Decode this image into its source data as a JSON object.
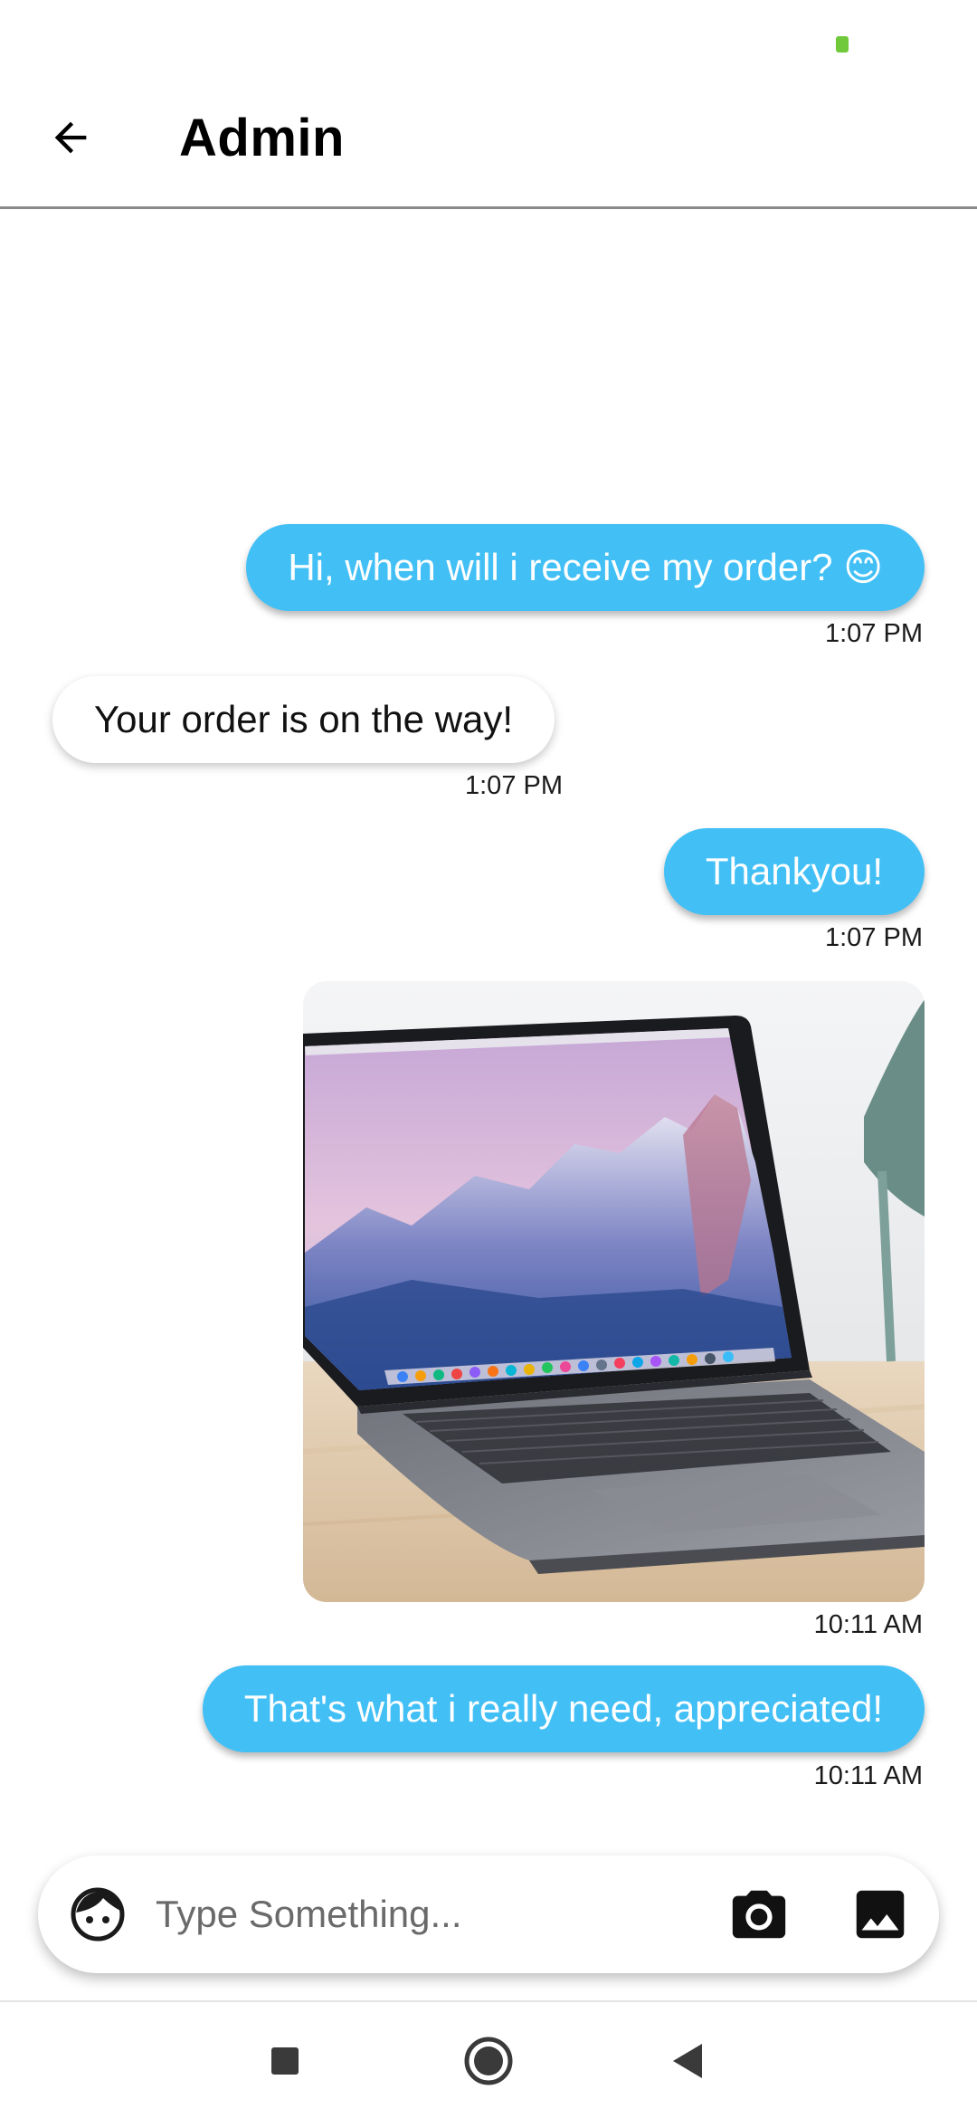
{
  "header": {
    "title": "Admin"
  },
  "messages": [
    {
      "direction": "outgoing",
      "type": "text",
      "text": "Hi, when will i receive my order? 😊",
      "time": "1:07 PM"
    },
    {
      "direction": "incoming",
      "type": "text",
      "text": "Your order is on the way!",
      "time": "1:07 PM"
    },
    {
      "direction": "outgoing",
      "type": "text",
      "text": "Thankyou!",
      "time": "1:07 PM"
    },
    {
      "direction": "outgoing",
      "type": "image",
      "image": "laptop-photo",
      "time": "10:11 AM"
    },
    {
      "direction": "outgoing",
      "type": "text",
      "text": "That's what i really need, appreciated!",
      "time": "10:11 AM"
    }
  ],
  "composer": {
    "placeholder": "Type Something...",
    "value": ""
  },
  "icons": {
    "back": "arrow-left-icon",
    "emoji": "face-icon",
    "camera": "camera-icon",
    "gallery": "image-icon",
    "nav_recents": "square-icon",
    "nav_home": "circle-icon",
    "nav_back": "triangle-back-icon"
  },
  "colors": {
    "outgoing_bubble": "#42c0f6",
    "incoming_bubble": "#ffffff",
    "status_dot": "#6fc93a"
  }
}
